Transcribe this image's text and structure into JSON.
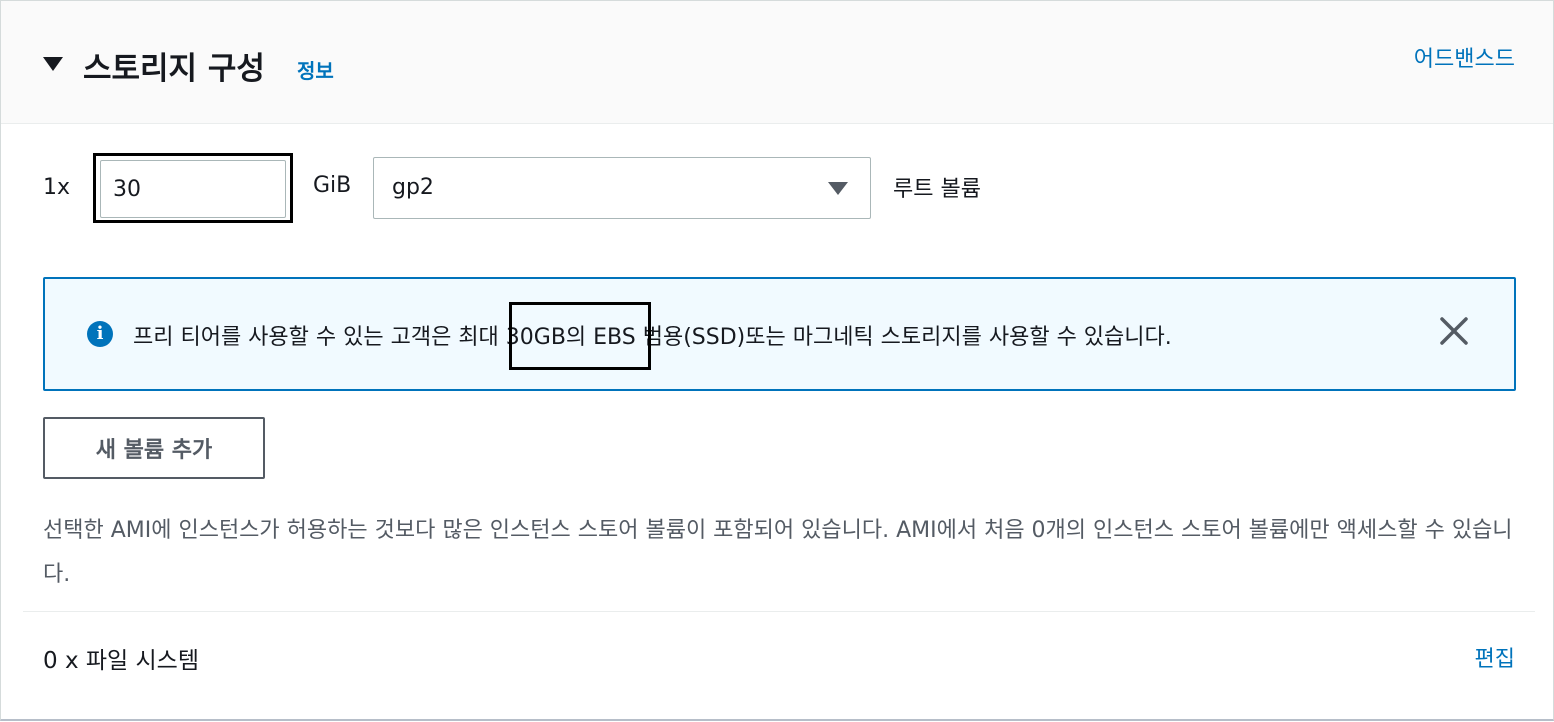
{
  "header": {
    "title": "스토리지 구성",
    "info_link": "정보",
    "advanced_link": "어드밴스드"
  },
  "volume": {
    "count_label": "1x",
    "size_value": "30",
    "unit": "GiB",
    "type_selected": "gp2",
    "role_label": "루트 볼륨"
  },
  "alert": {
    "icon": "info-icon",
    "text": "프리 티어를 사용할 수 있는 고객은 최대 30GB의 EBS 범용(SSD)또는 마그네틱 스토리지를 사용할 수 있습니다.",
    "close_icon": "close-icon",
    "color": "#0073bb"
  },
  "add_volume_button": "새 볼륨 추가",
  "description": "선택한 AMI에 인스턴스가 허용하는 것보다 많은 인스턴스 스토어 볼륨이 포함되어 있습니다. AMI에서 처음 0개의 인스턴스 스토어 볼륨에만 액세스할 수 있습니다.",
  "file_systems": {
    "label": "0 x 파일 시스템",
    "edit_link": "편집"
  },
  "colors": {
    "link": "#0073bb",
    "text": "#16191f",
    "muted": "#545b64"
  }
}
